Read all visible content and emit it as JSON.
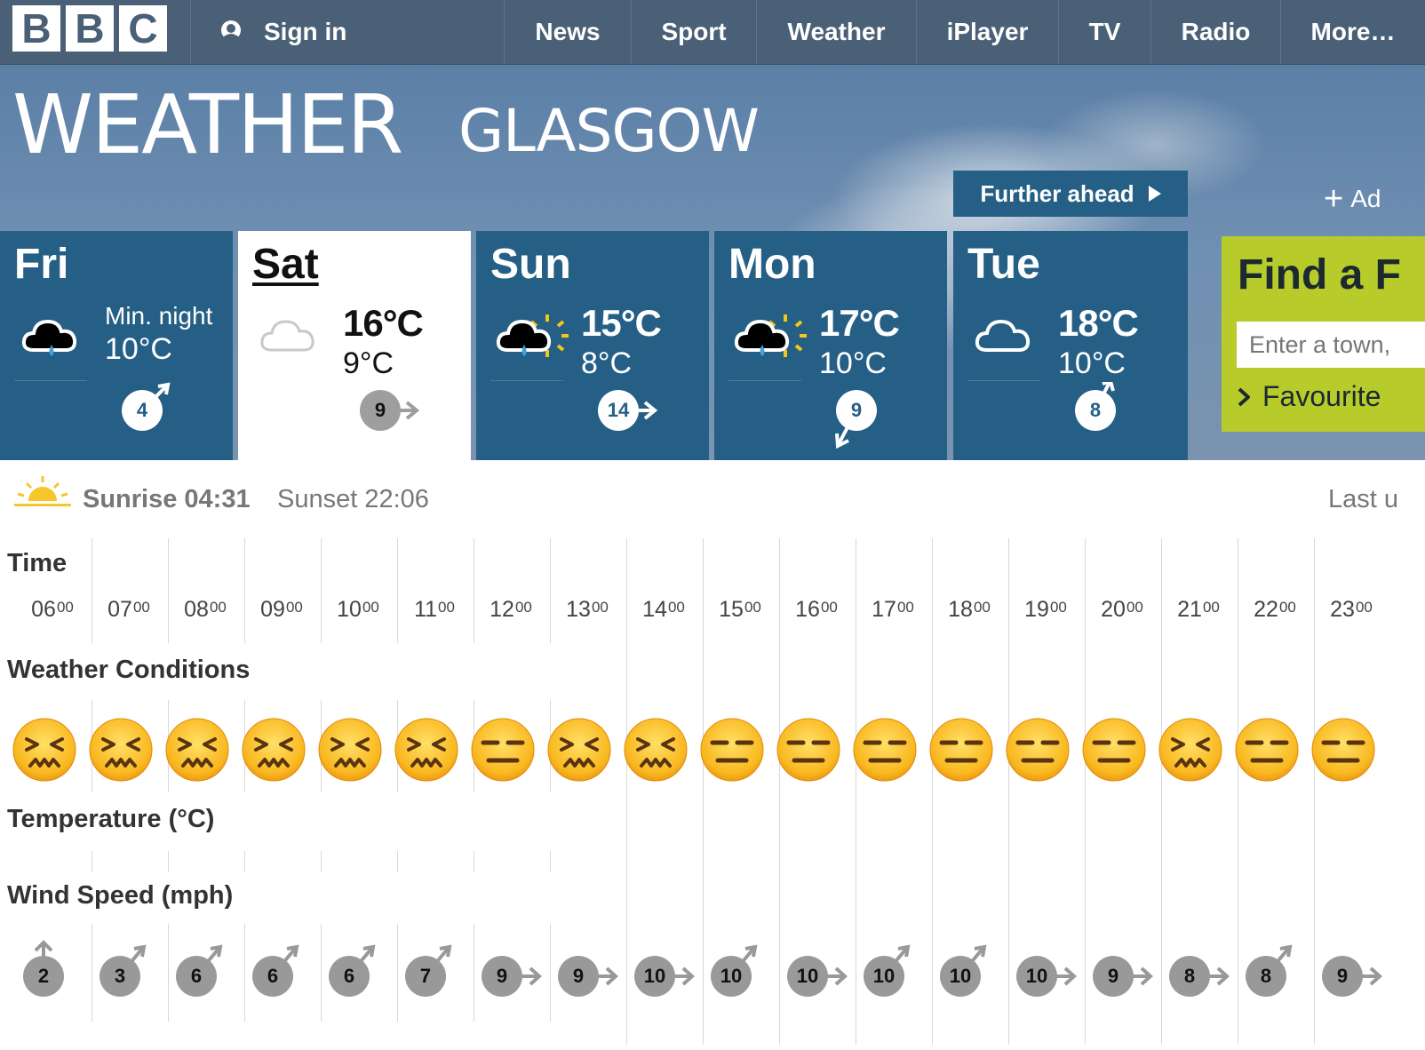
{
  "nav": {
    "logo": [
      "B",
      "B",
      "C"
    ],
    "sign_in": "Sign in",
    "items": [
      "News",
      "Sport",
      "Weather",
      "iPlayer",
      "TV",
      "Radio",
      "More…"
    ]
  },
  "banner": {
    "title": "WEATHER",
    "location": "GLASGOW",
    "further_ahead": "Further ahead",
    "add_location": "Ad"
  },
  "days": [
    {
      "name": "Fri",
      "icon": "cloud-rain-icon",
      "min_label": "Min. night",
      "max": "",
      "min": "10°C",
      "wind": "4",
      "wind_dir": "north-east",
      "active": false
    },
    {
      "name": "Sat",
      "icon": "cloud-icon",
      "min_label": "",
      "max": "16°C",
      "min": "9°C",
      "wind": "9",
      "wind_dir": "east",
      "active": true
    },
    {
      "name": "Sun",
      "icon": "sun-cloud-rain-icon",
      "min_label": "",
      "max": "15°C",
      "min": "8°C",
      "wind": "14",
      "wind_dir": "east",
      "active": false
    },
    {
      "name": "Mon",
      "icon": "sun-cloud-rain-icon",
      "min_label": "",
      "max": "17°C",
      "min": "10°C",
      "wind": "9",
      "wind_dir": "south-west",
      "active": false
    },
    {
      "name": "Tue",
      "icon": "cloud-icon",
      "min_label": "",
      "max": "18°C",
      "min": "10°C",
      "wind": "8",
      "wind_dir": "north-east",
      "active": false
    }
  ],
  "find": {
    "title": "Find a F",
    "placeholder": "Enter a town,",
    "favourites": "Favourite"
  },
  "sun": {
    "sunrise": "Sunrise 04:31",
    "sunset": "Sunset 22:06",
    "last_updated": "Last u"
  },
  "table": {
    "time_label": "Time",
    "conditions_label": "Weather Conditions",
    "temperature_label": "Temperature (°C)",
    "wind_label": "Wind Speed (mph)",
    "hours": [
      {
        "h": "06",
        "m": "00",
        "face": "confounded",
        "wind": "2",
        "dir": "north"
      },
      {
        "h": "07",
        "m": "00",
        "face": "confounded",
        "wind": "3",
        "dir": "north-east"
      },
      {
        "h": "08",
        "m": "00",
        "face": "confounded",
        "wind": "6",
        "dir": "north-east"
      },
      {
        "h": "09",
        "m": "00",
        "face": "confounded",
        "wind": "6",
        "dir": "north-east"
      },
      {
        "h": "10",
        "m": "00",
        "face": "confounded",
        "wind": "6",
        "dir": "north-east"
      },
      {
        "h": "11",
        "m": "00",
        "face": "confounded",
        "wind": "7",
        "dir": "north-east"
      },
      {
        "h": "12",
        "m": "00",
        "face": "expressionless",
        "wind": "9",
        "dir": "east"
      },
      {
        "h": "13",
        "m": "00",
        "face": "confounded",
        "wind": "9",
        "dir": "east"
      },
      {
        "h": "14",
        "m": "00",
        "face": "confounded",
        "wind": "10",
        "dir": "east"
      },
      {
        "h": "15",
        "m": "00",
        "face": "expressionless",
        "wind": "10",
        "dir": "north-east"
      },
      {
        "h": "16",
        "m": "00",
        "face": "expressionless",
        "wind": "10",
        "dir": "east"
      },
      {
        "h": "17",
        "m": "00",
        "face": "expressionless",
        "wind": "10",
        "dir": "north-east"
      },
      {
        "h": "18",
        "m": "00",
        "face": "expressionless",
        "wind": "10",
        "dir": "north-east"
      },
      {
        "h": "19",
        "m": "00",
        "face": "expressionless",
        "wind": "10",
        "dir": "east"
      },
      {
        "h": "20",
        "m": "00",
        "face": "expressionless",
        "wind": "9",
        "dir": "east"
      },
      {
        "h": "21",
        "m": "00",
        "face": "confounded",
        "wind": "8",
        "dir": "east"
      },
      {
        "h": "22",
        "m": "00",
        "face": "expressionless",
        "wind": "8",
        "dir": "north-east"
      },
      {
        "h": "23",
        "m": "00",
        "face": "expressionless",
        "wind": "9",
        "dir": "east"
      }
    ]
  },
  "colors": {
    "nav_bg": "#4a6077",
    "tab_bg": "#255f85",
    "find_bg": "#b7cc2b",
    "emoji_yellow": "#f9b820"
  }
}
